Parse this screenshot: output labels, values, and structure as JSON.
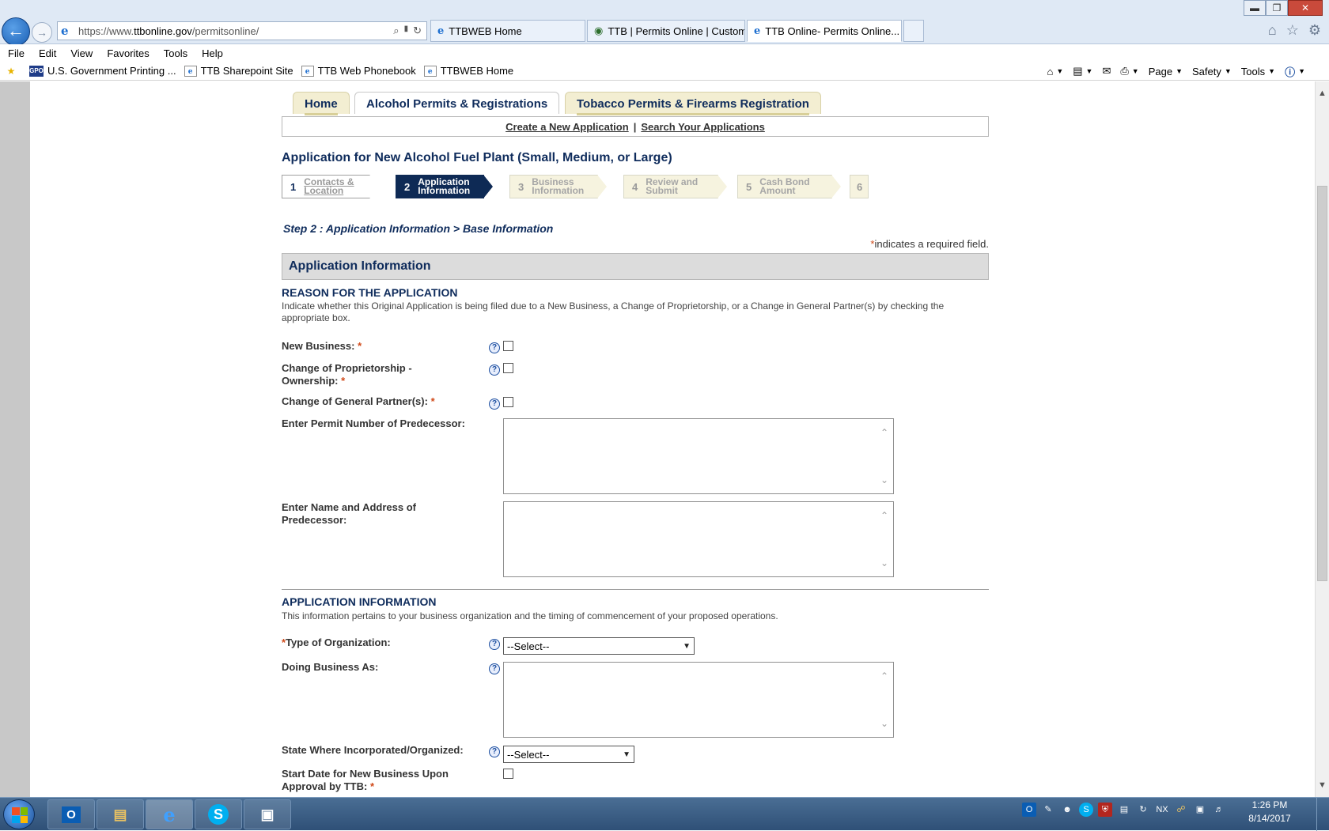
{
  "browser": {
    "url_prefix": "https://www.",
    "url_domain": "ttbonline.gov",
    "url_path": "/permitsonline/",
    "tabs": [
      {
        "title": "TTBWEB Home",
        "active": false
      },
      {
        "title": "TTB | Permits Online | Custom...",
        "active": false
      },
      {
        "title": "TTB Online- Permits Online...",
        "active": true
      }
    ],
    "menu": [
      "File",
      "Edit",
      "View",
      "Favorites",
      "Tools",
      "Help"
    ],
    "favorites": [
      "U.S. Government Printing ...",
      "TTB Sharepoint Site",
      "TTB Web Phonebook",
      "TTBWEB Home"
    ],
    "gpo_badge": "GPO",
    "commands": [
      "Page",
      "Safety",
      "Tools"
    ]
  },
  "site_nav": {
    "tabs": [
      "Home",
      "Alcohol Permits & Registrations",
      "Tobacco Permits & Firearms Registration"
    ],
    "links": [
      "Create a New Application",
      "Search Your Applications"
    ],
    "separator": "|"
  },
  "page": {
    "title": "Application for New Alcohol Fuel Plant (Small, Medium, or Large)",
    "steps": [
      {
        "num": "1",
        "label_line1": "Contacts &",
        "label_line2": "Location"
      },
      {
        "num": "2",
        "label_line1": "Application",
        "label_line2": "Information"
      },
      {
        "num": "3",
        "label_line1": "Business",
        "label_line2": "Information"
      },
      {
        "num": "4",
        "label_line1": "Review and Submit",
        "label_line2": ""
      },
      {
        "num": "5",
        "label_line1": "Cash Bond Amount",
        "label_line2": ""
      },
      {
        "num": "6",
        "label_line1": "",
        "label_line2": ""
      }
    ],
    "crumb": "Step 2 : Application Information > Base Information",
    "required_marker": "*",
    "required_note": "indicates a required field.",
    "section_header": "Application Information"
  },
  "reason": {
    "title": "REASON FOR THE APPLICATION",
    "description": "Indicate whether this Original Application is being filed due to a New Business, a Change of Proprietorship, or a Change in General Partner(s) by checking the appropriate box.",
    "new_business": "New Business:",
    "change_prop_line1": "Change of Proprietorship -",
    "change_prop_line2": "Ownership:",
    "change_partner": "Change of General Partner(s):",
    "predecessor_permit": "Enter Permit Number of Predecessor:",
    "predecessor_name": "Enter Name and Address of Predecessor:"
  },
  "app_info": {
    "title": "APPLICATION INFORMATION",
    "description": "This information pertains to your business organization and the timing of commencement of your proposed operations.",
    "org_type": "Type of Organization:",
    "org_type_value": "--Select--",
    "dba": "Doing Business As:",
    "state": "State Where Incorporated/Organized:",
    "state_value": "--Select--",
    "start_date_line1": "Start Date for New Business Upon",
    "start_date_line2": "Approval by TTB:"
  },
  "icons": {
    "help": "?",
    "search": "⌕",
    "lock": "🔒",
    "refresh": "↻",
    "home": "⌂",
    "star": "☆",
    "gear": "⚙"
  },
  "taskbar": {
    "time": "1:26 PM",
    "date": "8/14/2017"
  },
  "colors": {
    "navy": "#0f2c5c",
    "required": "#d04a1a",
    "step_current": "#0e2a55"
  }
}
